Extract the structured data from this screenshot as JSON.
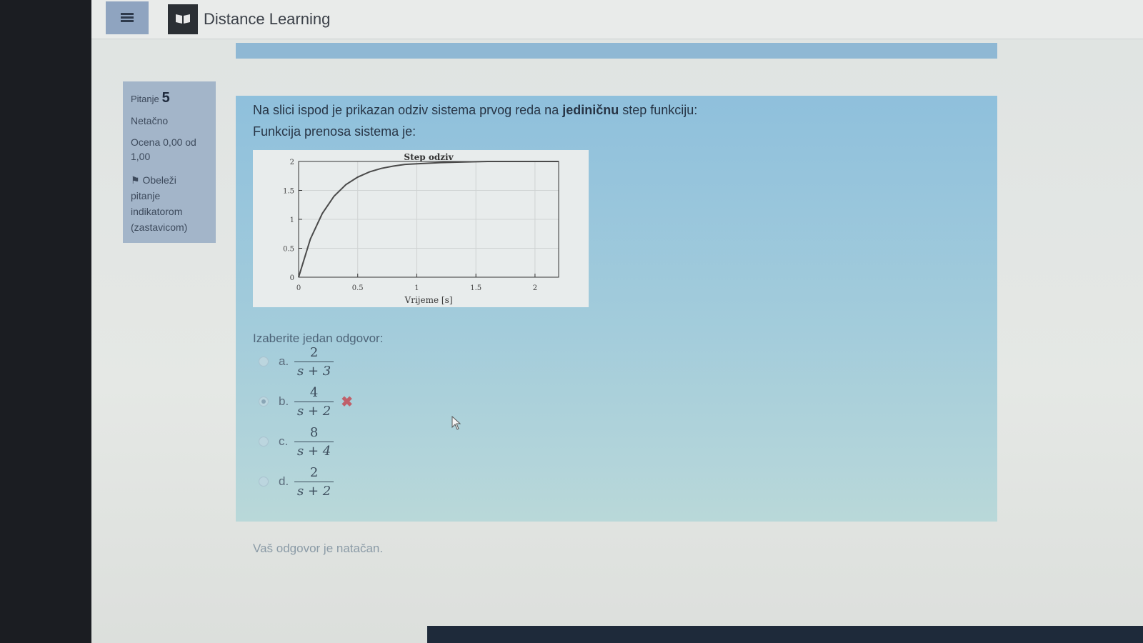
{
  "navbar": {
    "site_name": "Distance Learning",
    "menu_icon": "hamburger-icon",
    "logo_icon": "book-icon"
  },
  "info": {
    "question_label": "Pitanje",
    "question_number": "5",
    "status": "Netačno",
    "grade": "Ocena 0,00 od 1,00",
    "flag_label": "Obeleži pitanje indikatorom (zastavicom)",
    "flag_icon": "flag-icon"
  },
  "question": {
    "text_before": "Na slici ispod je prikazan odziv sistema prvog reda na ",
    "text_bold": "jediničnu",
    "text_after": " step funkciju:",
    "text2": "Funkcija prenosa sistema je:",
    "prompt": "Izaberite jedan odgovor:"
  },
  "answers": [
    {
      "letter": "a.",
      "num": "2",
      "den": "s + 3",
      "selected": false,
      "incorrect": false
    },
    {
      "letter": "b.",
      "num": "4",
      "den": "s + 2",
      "selected": true,
      "incorrect": true
    },
    {
      "letter": "c.",
      "num": "8",
      "den": "s + 4",
      "selected": false,
      "incorrect": false
    },
    {
      "letter": "d.",
      "num": "2",
      "den": "s + 2",
      "selected": false,
      "incorrect": false
    }
  ],
  "feedback": "Vaš odgovor je natačan.",
  "chart_data": {
    "type": "line",
    "title": "Step odziv",
    "xlabel": "Vrijeme [s]",
    "ylabel": "",
    "xlim": [
      0,
      2.2
    ],
    "ylim": [
      0,
      2
    ],
    "xticks": [
      "0",
      "0.5",
      "1",
      "1.5",
      "2"
    ],
    "yticks": [
      "0",
      "0.5",
      "1",
      "1.5",
      "2"
    ],
    "grid": true,
    "series": [
      {
        "color": "#4a4a4a",
        "x": [
          0,
          0.1,
          0.2,
          0.3,
          0.4,
          0.5,
          0.6,
          0.7,
          0.8,
          0.9,
          1.0,
          1.2,
          1.4,
          1.6,
          1.8,
          2.0,
          2.2
        ],
        "y": [
          0,
          0.66,
          1.1,
          1.4,
          1.6,
          1.73,
          1.82,
          1.88,
          1.92,
          1.95,
          1.96,
          1.98,
          1.99,
          2.0,
          2.0,
          2.0,
          2.0
        ]
      }
    ]
  },
  "colors": {
    "formulation_bg": "#8fc0dc",
    "info_bg": "#a3b5c9",
    "incorrect": "#c0606a"
  }
}
